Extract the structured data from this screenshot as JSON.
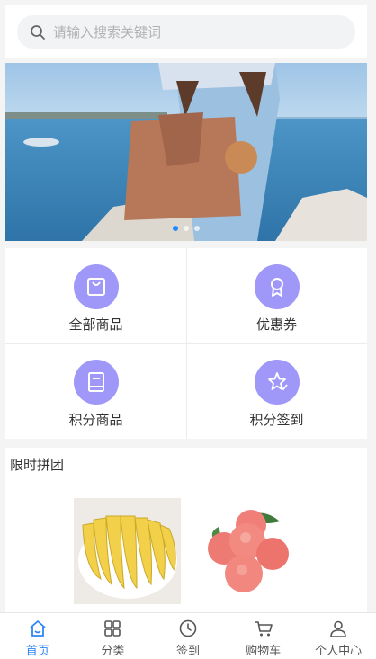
{
  "search": {
    "placeholder": "请输入搜索关键词"
  },
  "banner": {
    "slide_count": 3,
    "active_index": 0
  },
  "grid": [
    {
      "label": "全部商品",
      "icon": "shopping-bag-icon"
    },
    {
      "label": "优惠券",
      "icon": "badge-icon"
    },
    {
      "label": "积分商品",
      "icon": "book-icon"
    },
    {
      "label": "积分签到",
      "icon": "star-check-icon"
    }
  ],
  "group_buy": {
    "title": "限时拼团",
    "products": [
      {
        "image": "bananas"
      },
      {
        "image": "peaches"
      }
    ]
  },
  "tabbar": [
    {
      "label": "首页",
      "icon": "home-icon",
      "active": true
    },
    {
      "label": "分类",
      "icon": "category-icon",
      "active": false
    },
    {
      "label": "签到",
      "icon": "clock-icon",
      "active": false
    },
    {
      "label": "购物车",
      "icon": "cart-icon",
      "active": false
    },
    {
      "label": "个人中心",
      "icon": "user-icon",
      "active": false
    }
  ],
  "colors": {
    "accent": "#2f86f6",
    "icon_circle": "#9f98f8",
    "active_dot": "#1e8cff"
  }
}
